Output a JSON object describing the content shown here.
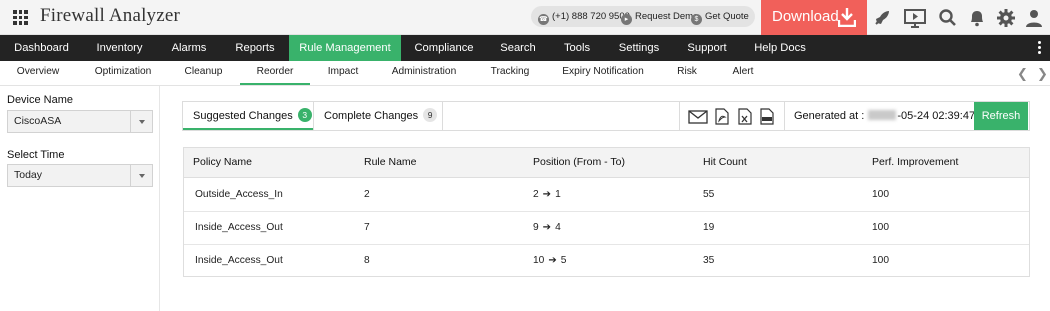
{
  "header": {
    "app_title": "Firewall Analyzer",
    "contact": {
      "phone": "(+1) 888 720 9500",
      "request_demo": "Request Demo",
      "get_quote": "Get Quote"
    },
    "download_label": "Download",
    "icons": [
      "rocket-icon",
      "demo-video-icon",
      "search-icon",
      "bell-icon",
      "gear-icon",
      "user-icon"
    ]
  },
  "main_nav": {
    "items": [
      {
        "label": "Dashboard"
      },
      {
        "label": "Inventory"
      },
      {
        "label": "Alarms"
      },
      {
        "label": "Reports"
      },
      {
        "label": "Rule Management",
        "active": true
      },
      {
        "label": "Compliance"
      },
      {
        "label": "Search"
      },
      {
        "label": "Tools"
      },
      {
        "label": "Settings"
      },
      {
        "label": "Support"
      },
      {
        "label": "Help Docs"
      }
    ],
    "active_color": "#39b26b"
  },
  "sub_nav": {
    "items": [
      {
        "label": "Overview"
      },
      {
        "label": "Optimization"
      },
      {
        "label": "Cleanup"
      },
      {
        "label": "Reorder",
        "active": true
      },
      {
        "label": "Impact"
      },
      {
        "label": "Administration"
      },
      {
        "label": "Tracking"
      },
      {
        "label": "Expiry Notification"
      },
      {
        "label": "Risk"
      },
      {
        "label": "Alert"
      }
    ]
  },
  "sidebar": {
    "device_label": "Device Name",
    "device_value": "CiscoASA",
    "time_label": "Select Time",
    "time_value": "Today"
  },
  "changes": {
    "suggested_label": "Suggested Changes",
    "suggested_count": "3",
    "complete_label": "Complete Changes",
    "complete_count": "9",
    "export_icons": [
      "mail-icon",
      "pdf-icon",
      "excel-icon",
      "csv-icon"
    ],
    "generated_prefix": "Generated at :",
    "generated_suffix": "-05-24 02:39:47.0",
    "refresh_label": "Refresh"
  },
  "table": {
    "headers": [
      "Policy Name",
      "Rule Name",
      "Position (From - To)",
      "Hit Count",
      "Perf. Improvement"
    ],
    "rows": [
      {
        "policy": "Outside_Access_In",
        "rule": "2",
        "from": "2",
        "to": "1",
        "hits": "55",
        "perf": "100"
      },
      {
        "policy": "Inside_Access_Out",
        "rule": "7",
        "from": "9",
        "to": "4",
        "hits": "19",
        "perf": "100"
      },
      {
        "policy": "Inside_Access_Out",
        "rule": "8",
        "from": "10",
        "to": "5",
        "hits": "35",
        "perf": "100"
      }
    ]
  }
}
